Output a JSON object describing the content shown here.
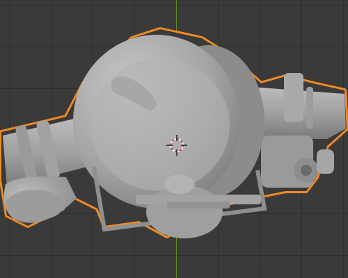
{
  "viewport": {
    "background_color": "#3a3a3a",
    "grid_color": "#2e2e2e",
    "y_axis_color": "#5e8a2a",
    "selection_outline_color": "#f08a24",
    "mesh_color": "#a8a8a8"
  },
  "scene": {
    "object": {
      "selected": true,
      "shading": "solid"
    },
    "cursor": {
      "icon": "3d-cursor-icon"
    }
  }
}
